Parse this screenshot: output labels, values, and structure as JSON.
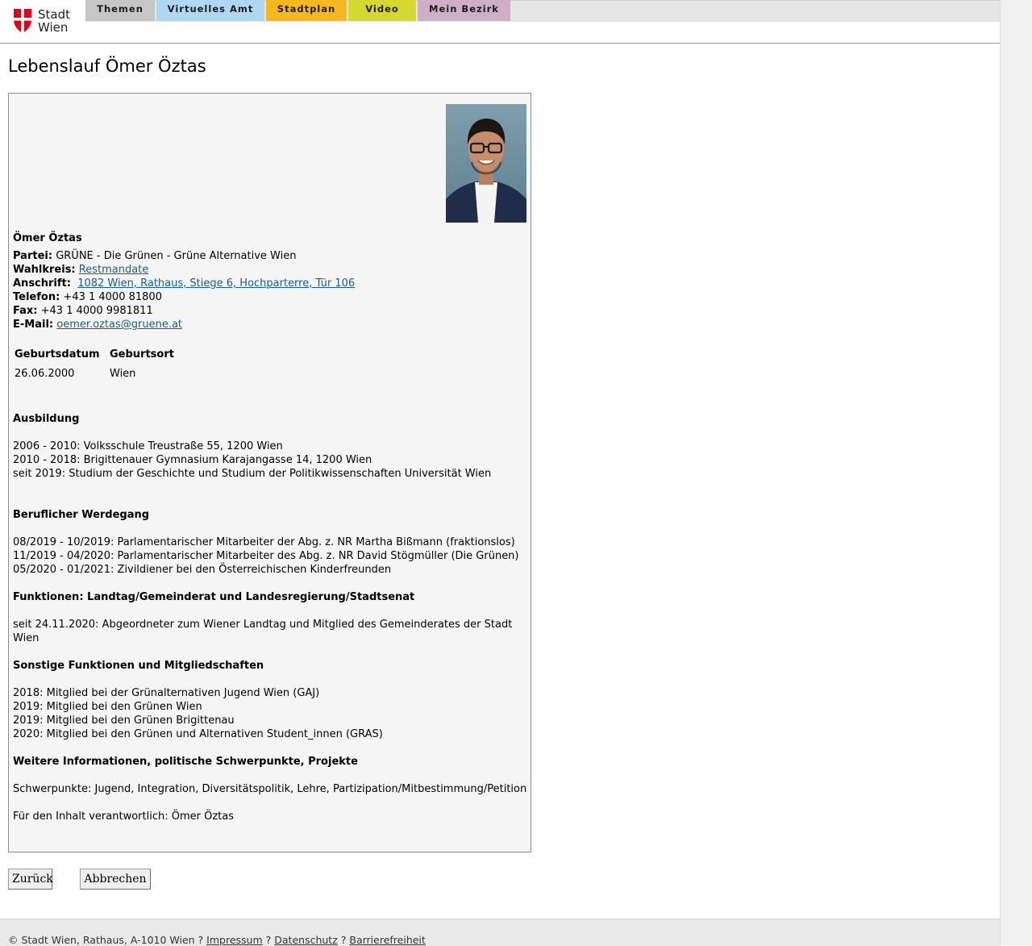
{
  "header": {
    "logo_line1": "Stadt",
    "logo_line2": "Wien",
    "tabs": [
      {
        "label": "Themen"
      },
      {
        "label": "Virtuelles Amt"
      },
      {
        "label": "Stadtplan"
      },
      {
        "label": "Video"
      },
      {
        "label": "Mein Bezirk"
      }
    ]
  },
  "page_title": "Lebenslauf Ömer Öztas",
  "profile": {
    "name": "Ömer Öztas",
    "contact": {
      "partei_label": "Partei:",
      "partei": "GRÜNE - Die Grünen - Grüne Alternative Wien",
      "wahlkreis_label": "Wahlkreis:",
      "wahlkreis": "Restmandate",
      "anschrift_label": "Anschrift:",
      "anschrift": "1082 Wien, Rathaus, Stiege 6, Hochparterre, Tür 106",
      "telefon_label": "Telefon:",
      "telefon": "+43 1 4000 81800",
      "fax_label": "Fax:",
      "fax": "+43 1 4000 9981811",
      "email_label": "E-Mail:",
      "email": "oemer.oztas@gruene.at"
    },
    "birth": {
      "col1_header": "Geburtsdatum",
      "col2_header": "Geburtsort",
      "date": "26.06.2000",
      "place": "Wien"
    },
    "sections": [
      {
        "title": "Ausbildung",
        "lines": [
          "2006 - 2010: Volksschule Treustraße 55, 1200 Wien",
          "2010 - 2018: Brigittenauer Gymnasium Karajangasse 14, 1200 Wien",
          "seit 2019: Studium der Geschichte und Studium der Politikwissenschaften Universität Wien"
        ]
      },
      {
        "title": "Beruflicher Werdegang",
        "lines": [
          "08/2019 - 10/2019: Parlamentarischer Mitarbeiter der Abg. z. NR Martha Bißmann (fraktionslos)",
          "11/2019 - 04/2020: Parlamentarischer Mitarbeiter des Abg. z. NR David Stögmüller (Die Grünen)",
          "05/2020 - 01/2021: Zivildiener bei den Österreichischen Kinderfreunden"
        ]
      },
      {
        "title": "Funktionen: Landtag/Gemeinderat und Landesregierung/Stadtsenat",
        "lines": [
          "seit 24.11.2020: Abgeordneter zum Wiener Landtag und Mitglied des Gemeinderates der Stadt Wien"
        ]
      },
      {
        "title": "Sonstige Funktionen und Mitgliedschaften",
        "lines": [
          "2018: Mitglied bei der Grünalternativen Jugend Wien (GAJ)",
          "2019: Mitglied bei den Grünen Wien",
          "2019: Mitglied bei den Grünen Brigittenau",
          "2020: Mitglied bei den Grünen und Alternativen Student_innen (GRAS)"
        ]
      },
      {
        "title": "Weitere Informationen, politische Schwerpunkte, Projekte",
        "lines": [
          "Schwerpunkte: Jugend, Integration, Diversitätspolitik, Lehre, Partizipation/Mitbestimmung/Petition"
        ]
      }
    ],
    "responsible": "Für den Inhalt verantwortlich: Ömer Öztas"
  },
  "buttons": {
    "back": "Zurück",
    "cancel": "Abbrechen"
  },
  "footer": {
    "copyright": "© Stadt Wien, Rathaus, A-1010 Wien ?",
    "sep": "?",
    "impressum": "Impressum",
    "datenschutz": "Datenschutz",
    "barrierefreiheit": "Barrierefreiheit"
  }
}
